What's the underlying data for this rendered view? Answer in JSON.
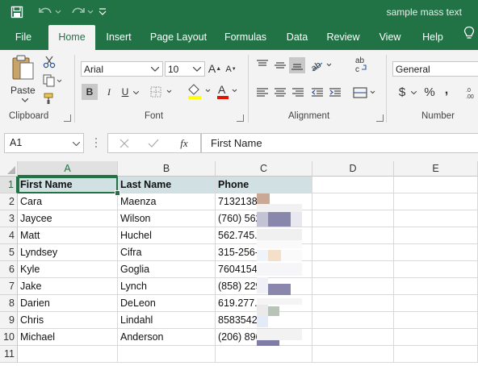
{
  "window": {
    "title": "sample mass text"
  },
  "quick_access": {
    "save_icon": "save-icon",
    "undo_icon": "undo-icon",
    "redo_icon": "redo-icon",
    "customize_icon": "customize-qat-icon"
  },
  "tabs": [
    "File",
    "Home",
    "Insert",
    "Page Layout",
    "Formulas",
    "Data",
    "Review",
    "View",
    "Help"
  ],
  "active_tab": "Home",
  "ribbon": {
    "clipboard": {
      "label": "Clipboard",
      "paste_label": "Paste"
    },
    "font": {
      "label": "Font",
      "family": "Arial",
      "size": "10",
      "bold": "B",
      "italic": "I",
      "underline": "U",
      "font_color": "#e51400",
      "fill_color": "#ffff00"
    },
    "alignment": {
      "label": "Alignment"
    },
    "number": {
      "label": "Number",
      "format": "General",
      "currency": "$",
      "percent": "%",
      "comma": ","
    }
  },
  "formula_bar": {
    "name_box": "A1",
    "fx": "fx",
    "content": "First Name"
  },
  "grid": {
    "columns": [
      "A",
      "B",
      "C",
      "D",
      "E"
    ],
    "rows": [
      "1",
      "2",
      "3",
      "4",
      "5",
      "6",
      "7",
      "8",
      "9",
      "10",
      "11"
    ],
    "header": [
      "First Name",
      "Last Name",
      "Phone"
    ],
    "data": [
      [
        "Cara",
        "Maenza",
        "7132138"
      ],
      [
        "Jaycee",
        "Wilson",
        "(760) 562"
      ],
      [
        "Matt",
        "Huchel",
        "562.745."
      ],
      [
        "Lyndsey",
        "Cifra",
        "315-256-"
      ],
      [
        "Kyle",
        "Goglia",
        "7604154"
      ],
      [
        "Jake",
        "Lynch",
        "(858) 229"
      ],
      [
        "Darien",
        "DeLeon",
        "619.277."
      ],
      [
        "Chris",
        "Lindahl",
        "8583542"
      ],
      [
        "Michael",
        "Anderson",
        "(206) 896"
      ]
    ],
    "header_fill": "#d0e0e3"
  },
  "accent_color": "#217346"
}
